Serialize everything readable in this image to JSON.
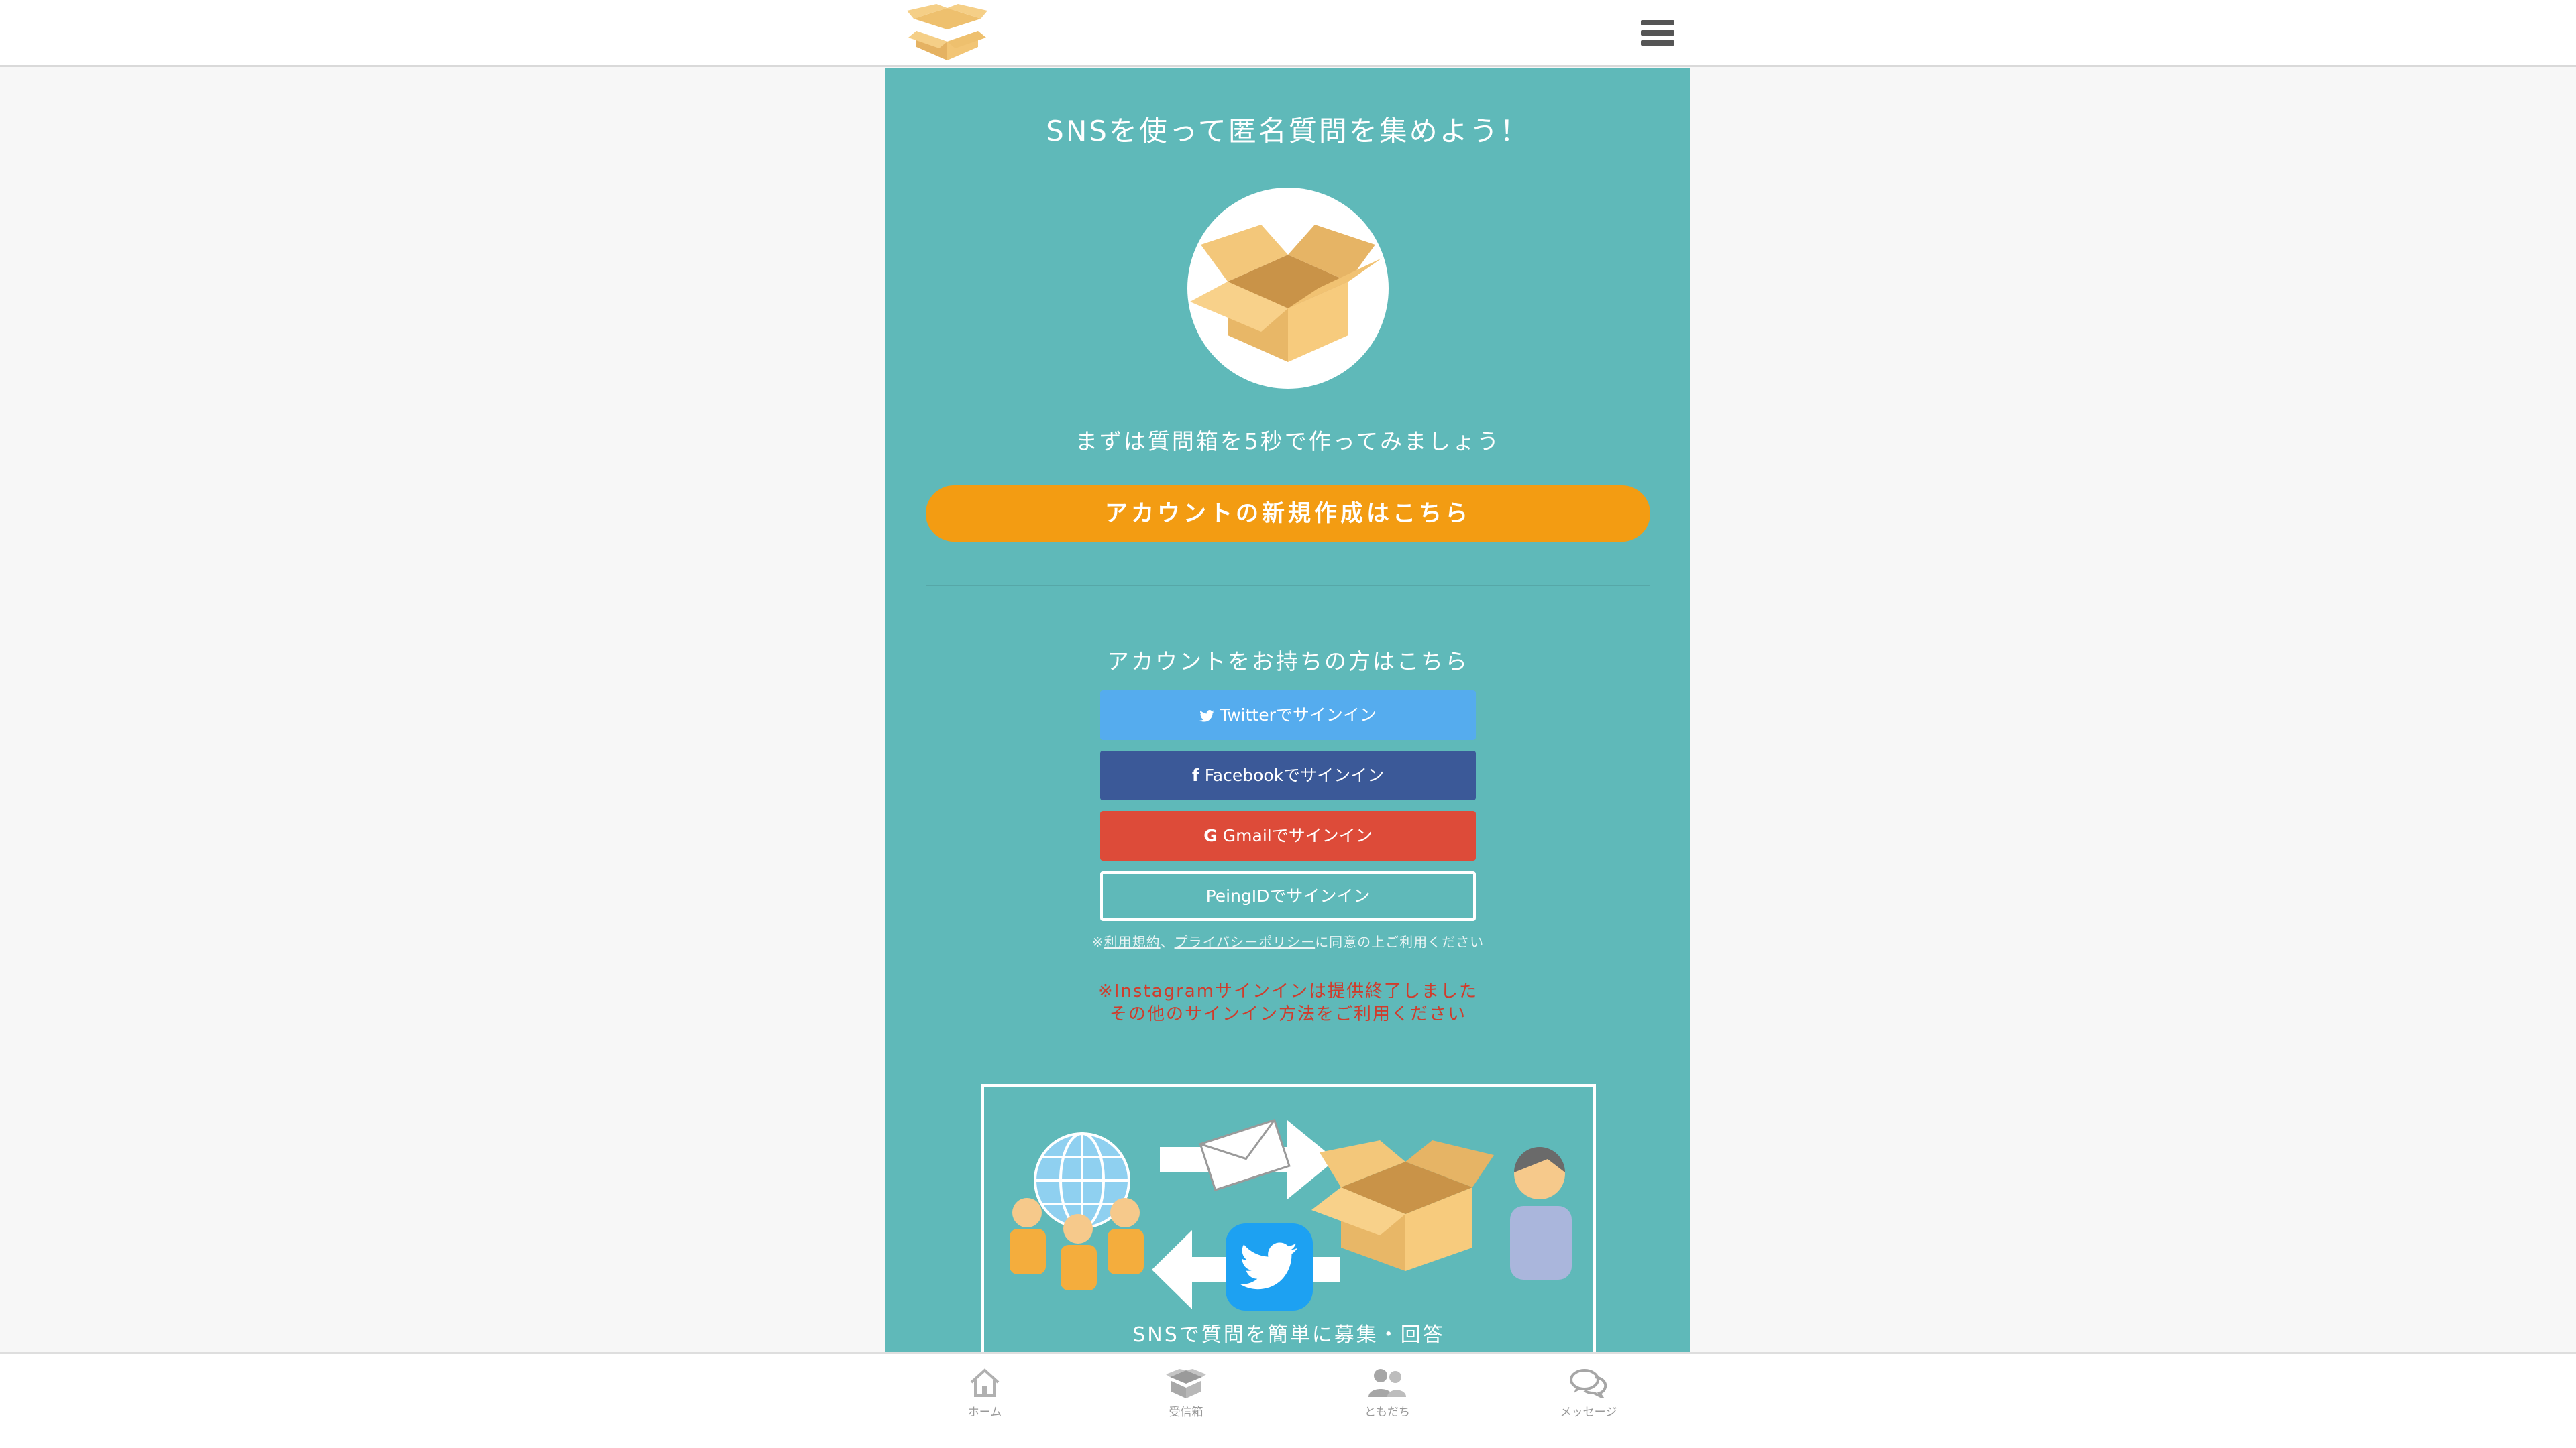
{
  "header": {
    "logo_icon": "cardboard-box-logo",
    "menu_icon": "hamburger-menu-icon"
  },
  "main": {
    "headline": "SNSを使って匿名質問を集めよう！",
    "intro": "まずは質問箱を5秒で作ってみましょう",
    "create_account_label": "アカウントの新規作成はこちら",
    "have_account_label": "アカウントをお持ちの方はこちら",
    "signin": {
      "twitter_label": "Twitterでサインイン",
      "facebook_label": "Facebookでサインイン",
      "gmail_label": "Gmailでサインイン",
      "peing_label": "PeingIDでサインイン"
    },
    "terms": {
      "prefix": "※",
      "terms_link": "利用規約",
      "separator": "、",
      "privacy_link": "プライバシーポリシー",
      "suffix": "に同意の上ご利用ください"
    },
    "notice": {
      "line1": "※Instagramサインインは提供終了しました",
      "line2": "その他のサインイン方法をご利用ください"
    },
    "feature_caption": "SNSで質問を簡単に募集・回答"
  },
  "bottom_nav": {
    "items": [
      {
        "label": "ホーム",
        "icon": "home-icon"
      },
      {
        "label": "受信箱",
        "icon": "inbox-box-icon"
      },
      {
        "label": "ともだち",
        "icon": "friends-icon"
      },
      {
        "label": "メッセージ",
        "icon": "chat-bubbles-icon"
      }
    ]
  },
  "colors": {
    "teal_background": "#5fb9b9",
    "create_button": "#f39c12",
    "twitter": "#55acee",
    "facebook": "#3b5998",
    "gmail": "#dd4b39",
    "notice_text": "#d03c2c"
  }
}
